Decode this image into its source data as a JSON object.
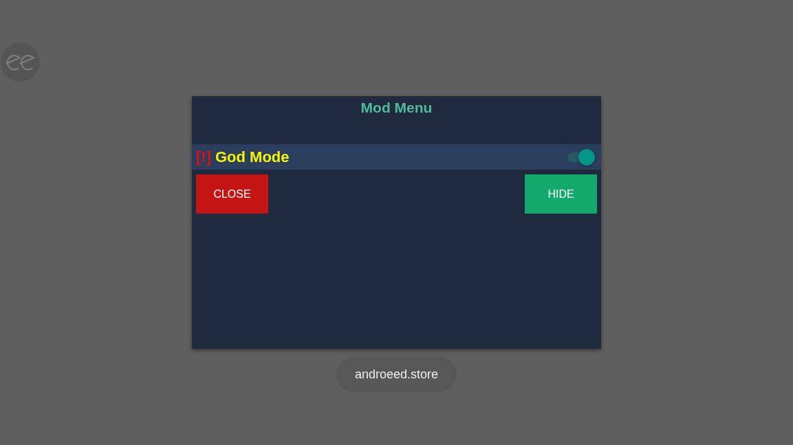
{
  "menu": {
    "title": "Mod Menu",
    "features": [
      {
        "kind": "toggle",
        "tag": "[!]",
        "label": "God Mode",
        "on": true
      }
    ],
    "buttons": [
      {
        "kind": "close",
        "label": "CLOSE"
      },
      {
        "kind": "hide",
        "label": "HIDE"
      }
    ]
  },
  "toast": {
    "text": "androeed.store"
  }
}
